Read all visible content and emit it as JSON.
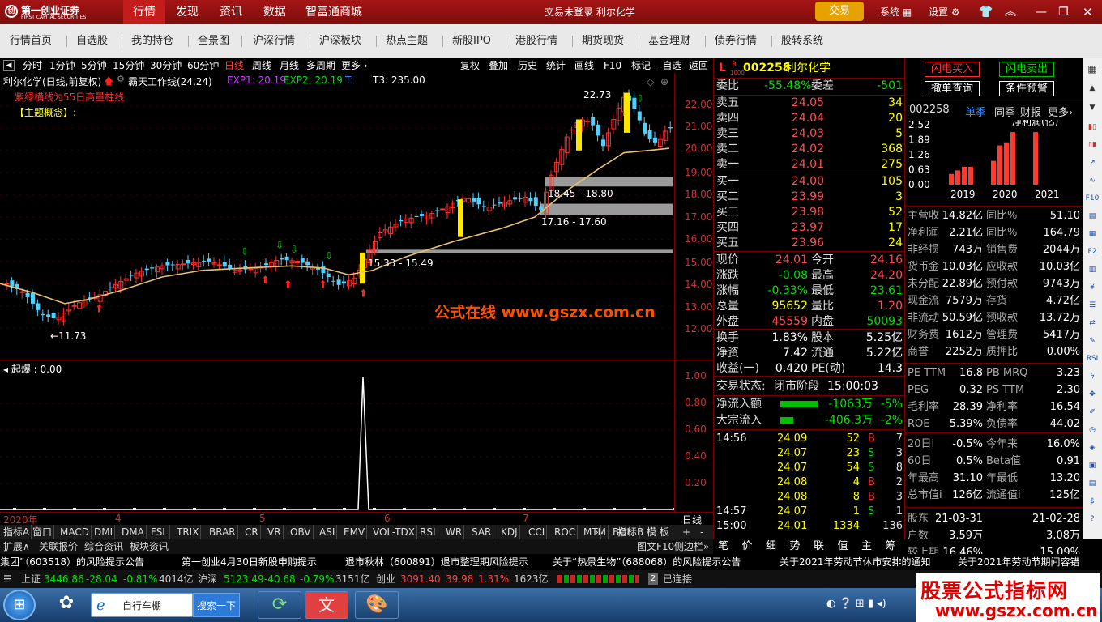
{
  "app": {
    "logo_name": "第一创业证券",
    "logo_sub": "FIRST CAPITAL SECURITIES",
    "logo_mark": "创"
  },
  "mainnav": [
    {
      "label": "行情",
      "active": true
    },
    {
      "label": "发现"
    },
    {
      "label": "资讯"
    },
    {
      "label": "数据"
    },
    {
      "label": "智富通商城"
    }
  ],
  "status_text": "交易未登录  利尔化学",
  "trade_button": "交易",
  "top_right": {
    "system": "系统",
    "settings": "设置"
  },
  "subnav": [
    "行情首页",
    "自选股",
    "我的持仓",
    "全景图",
    "沪深行情",
    "沪深板块",
    "热点主题",
    "新股IPO",
    "港股行情",
    "期货现货",
    "基金理财",
    "债券行情",
    "股转系统"
  ],
  "chartbar": {
    "periods": [
      "分时",
      "1分钟",
      "5分钟",
      "15分钟",
      "30分钟",
      "60分钟",
      "日线",
      "周线",
      "月线",
      "多周期",
      "更多"
    ],
    "selected": "日线",
    "tools": [
      "复权",
      "叠加",
      "历史",
      "统计",
      "画线",
      "F10",
      "标记",
      "-自选",
      "返回"
    ]
  },
  "main_chart": {
    "legend_title": "利尔化学(日线,前复权)",
    "indicator": "霸天工作线(24,24)",
    "exp1": "EXP1: 20.19",
    "exp2": "EXP2: 20.19",
    "t_label": "T:",
    "t3": "T3: 235.00",
    "note_red": "紫绿横线为55日高量柱线",
    "note_yellow": "【主题概念】:",
    "annotations": [
      "22.73",
      "18.45 - 18.80",
      "17.16 - 17.60",
      "15.33 - 15.49",
      "11.73"
    ],
    "watermark": "公式在线  www.gszx.com.cn",
    "y_ticks": [
      "22.00",
      "21.00",
      "20.00",
      "19.00",
      "18.00",
      "17.00",
      "16.00",
      "15.00",
      "14.00",
      "13.00",
      "12.00"
    ]
  },
  "sub_chart": {
    "title": "起爆 : 0.00",
    "y_ticks": [
      "1.00",
      "0.80",
      "0.60",
      "0.40",
      "0.20"
    ]
  },
  "x_axis": {
    "labels": [
      "2020年",
      "4",
      "5",
      "6",
      "7"
    ],
    "right": "日线"
  },
  "indicator_tabs": [
    "指标A",
    "窗口",
    "MACD",
    "DMI",
    "DMA",
    "FSL",
    "TRIX",
    "BRAR",
    "CR",
    "VR",
    "OBV",
    "ASI",
    "EMV",
    "VOL-TDX",
    "RSI",
    "WR",
    "SAR",
    "KDJ",
    "CCI",
    "ROC",
    "MTM",
    "BOLL"
  ],
  "indicator_right": [
    "指标B",
    "模 板",
    "+",
    "-"
  ],
  "bottom_left": [
    "扩展∧",
    "关联报价",
    "综合资讯",
    "板块资讯"
  ],
  "bottom_right": [
    "图文F10",
    "侧边栏»"
  ],
  "quote": {
    "code": "002258",
    "name": "利尔化学",
    "l_mark": "L",
    "r_mark": "R",
    "small": "1000",
    "weibi_label": "委比",
    "weibi": "-55.48%",
    "weicha_label": "委差",
    "weicha": "-501",
    "asks": [
      {
        "l": "卖五",
        "p": "24.05",
        "v": "34"
      },
      {
        "l": "卖四",
        "p": "24.04",
        "v": "20"
      },
      {
        "l": "卖三",
        "p": "24.03",
        "v": "5"
      },
      {
        "l": "卖二",
        "p": "24.02",
        "v": "368"
      },
      {
        "l": "卖一",
        "p": "24.01",
        "v": "275"
      }
    ],
    "bids": [
      {
        "l": "买一",
        "p": "24.00",
        "v": "105"
      },
      {
        "l": "买二",
        "p": "23.99",
        "v": "3"
      },
      {
        "l": "买三",
        "p": "23.98",
        "v": "52"
      },
      {
        "l": "买四",
        "p": "23.97",
        "v": "17"
      },
      {
        "l": "买五",
        "p": "23.96",
        "v": "24"
      }
    ],
    "stats": [
      {
        "l1": "现价",
        "v1": "24.01",
        "l2": "今开",
        "v2": "24.16"
      },
      {
        "l1": "涨跌",
        "v1": "-0.08",
        "l2": "最高",
        "v2": "24.20"
      },
      {
        "l1": "涨幅",
        "v1": "-0.33%",
        "l2": "最低",
        "v2": "23.61"
      },
      {
        "l1": "总量",
        "v1": "95652",
        "l2": "量比",
        "v2": "1.20"
      },
      {
        "l1": "外盘",
        "v1": "45559",
        "l2": "内盘",
        "v2": "50093"
      }
    ],
    "stats2": [
      {
        "l1": "换手",
        "v1": "1.83%",
        "l2": "股本",
        "v2": "5.25亿"
      },
      {
        "l1": "净资",
        "v1": "7.42",
        "l2": "流通",
        "v2": "5.22亿"
      },
      {
        "l1": "收益(一)",
        "v1": "0.420",
        "l2": "PE(动)",
        "v2": "14.3"
      }
    ],
    "trade_state_label": "交易状态:",
    "trade_state": "闭市阶段",
    "trade_time": "15:00:03",
    "netflow_label": "净流入额",
    "netflow": "-1063万",
    "netflow_pct": "-5%",
    "bigflow_label": "大宗流入",
    "bigflow": "-406.3万",
    "bigflow_pct": "-2%",
    "ticks": [
      {
        "t": "14:56",
        "p": "24.09",
        "v": "52",
        "d": "B",
        "n": "7"
      },
      {
        "t": "",
        "p": "24.07",
        "v": "23",
        "d": "S",
        "n": "3"
      },
      {
        "t": "",
        "p": "24.07",
        "v": "54",
        "d": "S",
        "n": "8"
      },
      {
        "t": "",
        "p": "24.08",
        "v": "4",
        "d": "B",
        "n": "2"
      },
      {
        "t": "",
        "p": "24.08",
        "v": "8",
        "d": "B",
        "n": "3"
      },
      {
        "t": "14:57",
        "p": "24.07",
        "v": "1",
        "d": "S",
        "n": "1"
      },
      {
        "t": "15:00",
        "p": "24.01",
        "v": "1334",
        "d": "",
        "n": "136"
      }
    ],
    "tabs": [
      "笔",
      "价",
      "细",
      "势",
      "联",
      "值",
      "主",
      "筹"
    ]
  },
  "fin": {
    "buttons": [
      "闪电买入",
      "闪电卖出",
      "撤单查询",
      "条件预警"
    ],
    "code": "002258",
    "tabs": [
      "单季",
      "同季",
      "财报",
      "更多"
    ],
    "chart_title": "净利润(亿)",
    "bar_colors": {
      "2019": "#ff3b30",
      "2020": "#ff3b30",
      "2021": "#ff3b30"
    },
    "rows1": [
      {
        "l1": "主营收",
        "v1": "14.82亿",
        "l2": "同比%",
        "v2": "51.10"
      },
      {
        "l1": "净利润",
        "v1": "2.21亿",
        "l2": "同比%",
        "v2": "164.79"
      },
      {
        "l1": "非经损",
        "v1": "743万",
        "l2": "销售费",
        "v2": "2044万"
      },
      {
        "l1": "货币金",
        "v1": "10.03亿",
        "l2": "应收款",
        "v2": "10.03亿"
      },
      {
        "l1": "未分配",
        "v1": "22.89亿",
        "l2": "预付款",
        "v2": "9743万"
      },
      {
        "l1": "现金流",
        "v1": "7579万",
        "l2": "存货",
        "v2": "4.72亿"
      },
      {
        "l1": "非流动",
        "v1": "50.59亿",
        "l2": "预收款",
        "v2": "13.72万"
      },
      {
        "l1": "财务费",
        "v1": "1612万",
        "l2": "管理费",
        "v2": "5417万"
      },
      {
        "l1": "商誉",
        "v1": "2252万",
        "l2": "质押比",
        "v2": "0.00%"
      }
    ],
    "rows2": [
      {
        "l1": "PE TTM",
        "v1": "16.8",
        "l2": "PB MRQ",
        "v2": "3.23"
      },
      {
        "l1": "PEG",
        "v1": "0.32",
        "l2": "PS TTM",
        "v2": "2.30"
      },
      {
        "l1": "毛利率",
        "v1": "28.39",
        "l2": "净利率",
        "v2": "16.54"
      },
      {
        "l1": "ROE",
        "v1": "5.39%",
        "l2": "负债率",
        "v2": "44.02"
      }
    ],
    "rows3": [
      {
        "l1": "20日i",
        "v1": "-0.5%",
        "l2": "今年来",
        "v2": "16.0%"
      },
      {
        "l1": "60日",
        "v1": "0.5%",
        "l2": "Beta值",
        "v2": "0.91"
      },
      {
        "l1": "年最高",
        "v1": "31.10",
        "l2": "年最低",
        "v2": "13.20"
      },
      {
        "l1": "总市值i",
        "v1": "126亿",
        "l2": "流通值i",
        "v2": "125亿"
      }
    ],
    "rows4": [
      {
        "l1": "股东",
        "v1": "21-03-31",
        "l2": "",
        "v2": "21-02-28"
      },
      {
        "l1": "户数",
        "v1": "3.59万",
        "l2": "",
        "v2": "3.08万"
      },
      {
        "l1": "较上期",
        "v1": "16.46%",
        "l2": "",
        "v2": "15.09%"
      }
    ]
  },
  "chart_data": {
    "type": "bar",
    "categories": [
      "2019",
      "2020",
      "2021"
    ],
    "ylim": [
      0,
      2.52
    ],
    "y_ticks": [
      "2.52",
      "1.89",
      "1.26",
      "0.63",
      "0.00"
    ],
    "title": "净利润(亿)"
  },
  "news": [
    "集团”（603518）的风险提示公告",
    "第一创业4月30日新股申购提示",
    "退市秋林（600891）退市整理期风险提示",
    "关于“热景生物”（688068）的风险提示公告",
    "关于2021年劳动节休市安排的通知",
    "关于2021年劳动节期间容错"
  ],
  "indices": [
    {
      "name": "上证",
      "v": "3446.86",
      "c": "-28.04",
      "p": "-0.81%",
      "a": "4014亿"
    },
    {
      "name": "沪深",
      "v": "5123.49",
      "c": "-40.68",
      "p": "-0.79%",
      "a": "3151亿"
    },
    {
      "name": "创业",
      "v": "3091.40",
      "c": "39.98",
      "p": "1.31%",
      "a": "1623亿"
    }
  ],
  "connect": {
    "num": "2",
    "text": "已连接"
  },
  "taskbar": {
    "app1": "自行车棚",
    "search": "搜索一下"
  },
  "watermark_big": {
    "title": "股票公式指标网",
    "url": "www.gszx.com.cn"
  }
}
